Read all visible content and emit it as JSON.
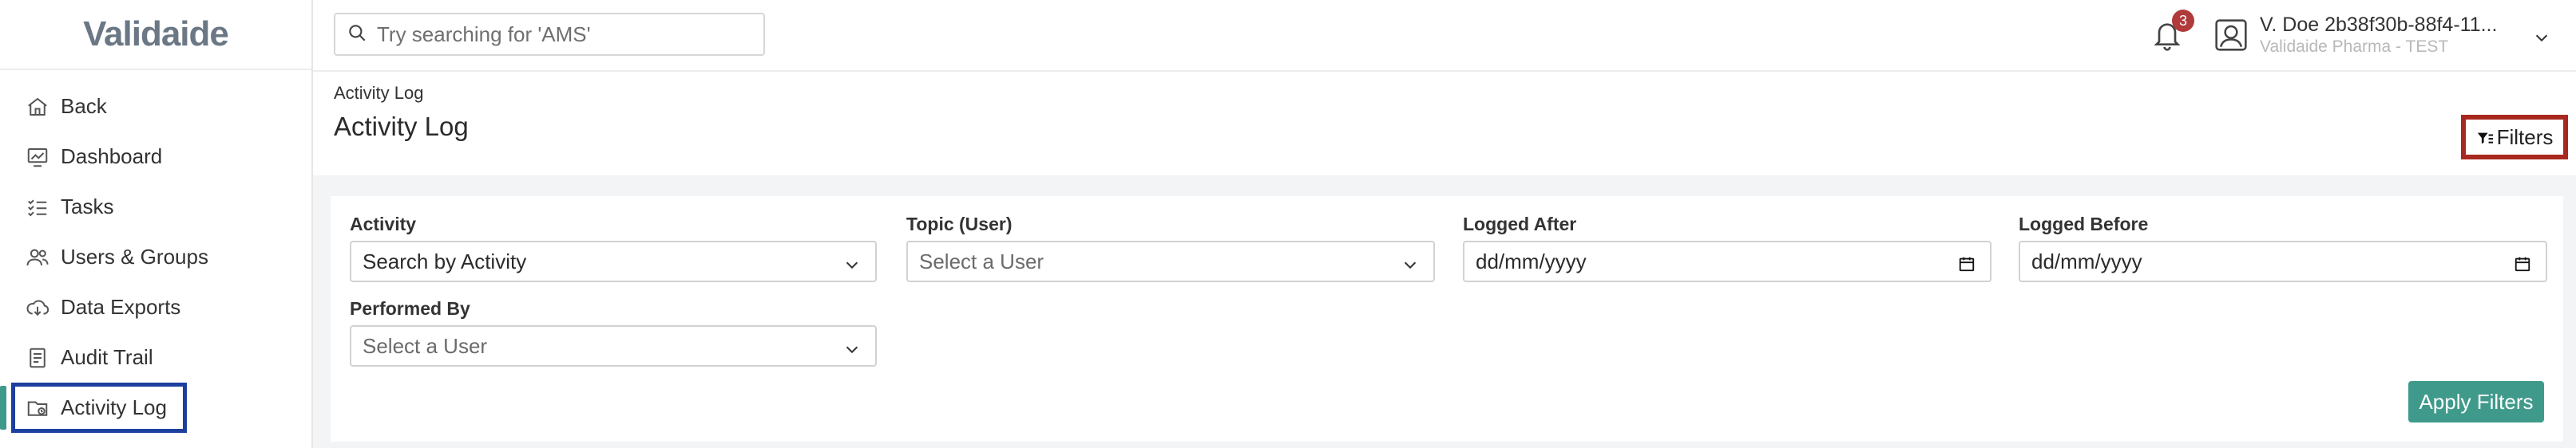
{
  "brand": {
    "logo_text": "Validaide",
    "logo_accent_color": "#3f9a8b"
  },
  "search": {
    "placeholder": "Try searching for 'AMS'"
  },
  "notifications": {
    "count": "3"
  },
  "user": {
    "name": "V. Doe 2b38f30b-88f4-11...",
    "org": "Validaide Pharma - TEST"
  },
  "sidebar": {
    "items": [
      {
        "label": "Back",
        "icon": "home-icon"
      },
      {
        "label": "Dashboard",
        "icon": "dashboard-icon"
      },
      {
        "label": "Tasks",
        "icon": "tasks-icon"
      },
      {
        "label": "Users & Groups",
        "icon": "users-icon"
      },
      {
        "label": "Data Exports",
        "icon": "cloud-download-icon"
      },
      {
        "label": "Audit Trail",
        "icon": "audit-icon"
      },
      {
        "label": "Activity Log",
        "icon": "activity-log-icon",
        "active": true
      }
    ]
  },
  "page": {
    "breadcrumb": "Activity Log",
    "title": "Activity Log",
    "filters_button": "Filters"
  },
  "filters": {
    "activity": {
      "label": "Activity",
      "value": "Search by Activity"
    },
    "topic_user": {
      "label": "Topic (User)",
      "placeholder": "Select a User"
    },
    "logged_after": {
      "label": "Logged After",
      "placeholder": "dd/mm/yyyy"
    },
    "logged_before": {
      "label": "Logged Before",
      "placeholder": "dd/mm/yyyy"
    },
    "performed_by": {
      "label": "Performed By",
      "placeholder": "Select a User"
    },
    "apply_button": "Apply Filters"
  },
  "colors": {
    "accent": "#3f9a8b",
    "active_nav_border": "#1d3f9e",
    "filters_highlight": "#a8281f",
    "badge": "#b13a3a"
  }
}
